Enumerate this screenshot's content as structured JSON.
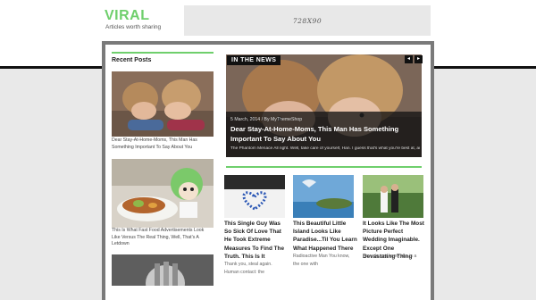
{
  "site": {
    "title": "VIRAL",
    "tagline": "Articles worth sharing"
  },
  "ad": {
    "label": "728X90"
  },
  "sidebar": {
    "heading": "Recent Posts",
    "posts": [
      {
        "caption": "Dear Stay-At-Home-Moms, This Man Has Something Important To Say About You"
      },
      {
        "caption": "This Is What Fast Food Advertisements Look Like Versus The Real Thing, Well, That's A Letdown"
      }
    ]
  },
  "slider": {
    "label": "IN THE NEWS",
    "prev_icon": "◂",
    "next_icon": "▸",
    "meta": "5 March, 2014 / By MyThemeShop",
    "title": "Dear Stay-At-Home-Moms, This Man Has Something Important To Say About You",
    "excerpt": "The Phantom Menace All right. Well, take care of yourself, Han. I guess that's what you're best at, ain't"
  },
  "posts": [
    {
      "title": "This Single Guy Was So Sick Of Love That He Took Extreme Measures To Find The Truth. This Is It",
      "excerpt": "Thank you, steal again. Human contact: the"
    },
    {
      "title": "This Beautiful Little Island Looks Like Paradise...Til You Learn What Happened There",
      "excerpt": "Radioactive Man You know, the one with"
    },
    {
      "title": "It Looks Like The Most Picture Perfect Wedding Imaginable. Except One Devastating Thing",
      "excerpt": "How do you know she is a"
    }
  ]
}
